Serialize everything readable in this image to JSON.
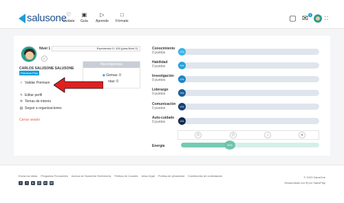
{
  "brand": {
    "name": "salusone"
  },
  "nav": [
    {
      "label": "Cuídate",
      "icon": "heart-icon"
    },
    {
      "label": "Guía",
      "icon": "bag-icon"
    },
    {
      "label": "Aprende",
      "icon": "play-icon"
    },
    {
      "label": "Fórmate",
      "icon": "book-icon"
    }
  ],
  "header": {
    "notification_count": "0"
  },
  "profile": {
    "level": "Nivel 1",
    "experience": "Experiencia 0 / 100 (para Nivel 2)",
    "name": "CARLOS SALUSONE SALUSONE",
    "badge": "Premium Plus",
    "menu": [
      "Validar Premium",
      "Editar perfil",
      "Temas de interés",
      "Seguir a organizaciones"
    ],
    "logout": "Cerrar sesión"
  },
  "rewards": {
    "title": "Recompensas",
    "gems_label": "Gemas:",
    "gems_value": "0",
    "coins_label": "ntas:",
    "coins_value": "0"
  },
  "stats": [
    {
      "name": "Conocimiento",
      "points": "0 puntos",
      "value": "0%",
      "color": "#3ab5e6"
    },
    {
      "name": "Habilidad",
      "points": "0 puntos",
      "value": "0%",
      "color": "#24a2d8"
    },
    {
      "name": "Investigación",
      "points": "0 puntos",
      "value": "0%",
      "color": "#1a86c2"
    },
    {
      "name": "Liderazgo",
      "points": "0 puntos",
      "value": "0%",
      "color": "#1a5c9a"
    },
    {
      "name": "Comunicación",
      "points": "0 puntos",
      "value": "0%",
      "color": "#173f75"
    },
    {
      "name": "Auto-cuidado",
      "points": "0 puntos",
      "value": "0%",
      "color": "#12284e"
    }
  ],
  "energy": {
    "label": "Energía",
    "value": "35%",
    "level": 0.35
  },
  "footer": {
    "links": [
      "Envía tus ideas",
      "Preguntas Frecuentes",
      "Acerca de SalusOne Enfermería",
      "Política de Cookies",
      "Aviso legal",
      "Política de privacidad",
      "Condiciones de contratación"
    ],
    "copyright": "© 2023 SalusOne",
    "developed": "Desarrollado con ♥ por SalusPlay"
  }
}
